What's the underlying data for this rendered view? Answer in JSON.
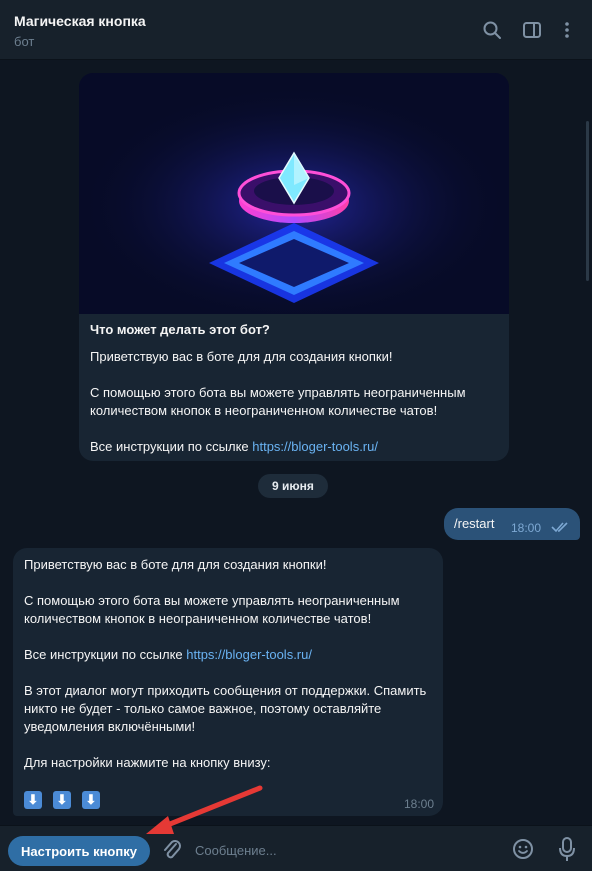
{
  "header": {
    "title": "Магическая кнопка",
    "subtitle": "бот",
    "icons": [
      "search-icon",
      "sidebar-toggle-icon",
      "more-vertical-icon"
    ]
  },
  "intro_card": {
    "title": "Что может делать этот бот?",
    "p1": "Приветствую вас в боте для для создания кнопки!",
    "p2": "С помощью этого бота вы можете управлять неограниченным количеством кнопок в неограниченном количестве чатов!",
    "p3_prefix": "Все инструкции по ссылке ",
    "p3_link": "https://bloger-tools.ru/"
  },
  "date_separator": "9 июня",
  "outgoing": {
    "text": "/restart",
    "time": "18:00",
    "status": "read"
  },
  "incoming": {
    "p1": "Приветствую вас в боте для для создания кнопки!",
    "p2": "С помощью этого бота вы можете управлять неограниченным количеством кнопок в неограниченном количестве чатов!",
    "p3_prefix": "Все инструкции по ссылке ",
    "p3_link": "https://bloger-tools.ru/",
    "p4": "В этот диалог могут приходить сообщения от  поддержки. Спамить никто не будет - только самое важное, поэтому оставляйте уведомления включёнными!",
    "p5": "Для настройки нажмите на кнопку внизу:",
    "emoji": [
      "⬇",
      "⬇",
      "⬇"
    ],
    "time": "18:00"
  },
  "composer": {
    "menu_button": "Настроить кнопку",
    "placeholder": "Сообщение..."
  },
  "colors": {
    "background": "#0e1621",
    "header": "#17212b",
    "bubble_in": "#182533",
    "bubble_out": "#2b5278",
    "link": "#6ab3f3",
    "menu_button": "#2f6ea5",
    "annotation_arrow": "#e53935"
  }
}
